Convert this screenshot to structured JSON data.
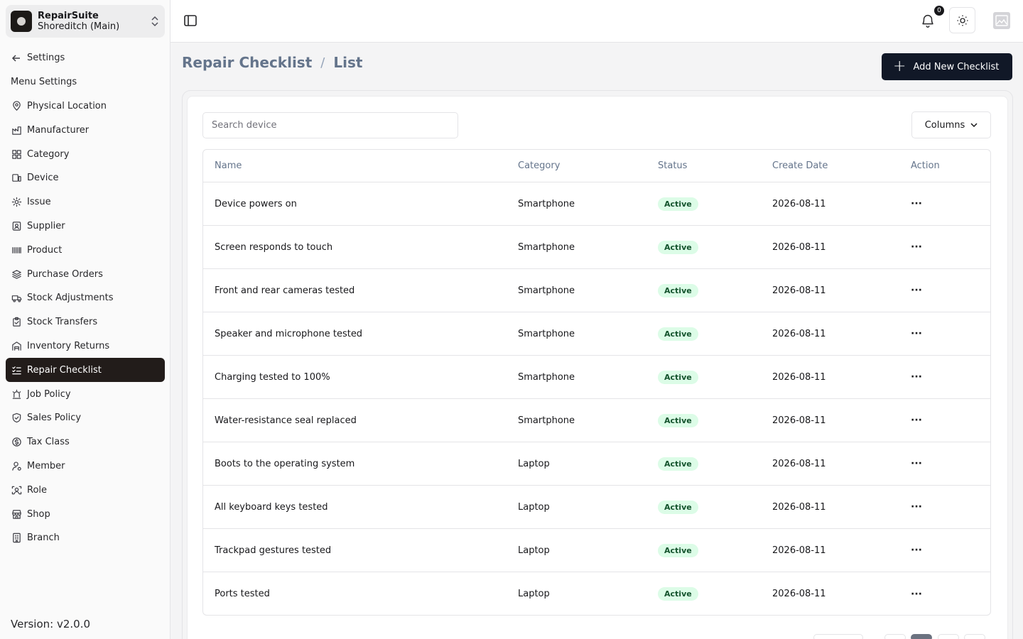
{
  "app": {
    "name": "RepairSuite",
    "branch": "Shoreditch (Main)",
    "version": "Version: v2.0.0"
  },
  "sidebar": {
    "back_label": "Settings",
    "section_label": "Menu Settings",
    "items": [
      {
        "label": "Physical Location",
        "icon": "map-pin-icon"
      },
      {
        "label": "Manufacturer",
        "icon": "factory-icon"
      },
      {
        "label": "Category",
        "icon": "category-icon"
      },
      {
        "label": "Device",
        "icon": "devices-icon"
      },
      {
        "label": "Issue",
        "icon": "cog-icon"
      },
      {
        "label": "Supplier",
        "icon": "contact-icon"
      },
      {
        "label": "Product",
        "icon": "barcode-icon"
      },
      {
        "label": "Purchase Orders",
        "icon": "layers-icon"
      },
      {
        "label": "Stock Adjustments",
        "icon": "truck-icon"
      },
      {
        "label": "Stock Transfers",
        "icon": "clipboard-icon"
      },
      {
        "label": "Inventory Returns",
        "icon": "warehouse-icon"
      },
      {
        "label": "Repair Checklist",
        "icon": "checklist-icon",
        "active": true
      },
      {
        "label": "Job Policy",
        "icon": "siren-icon"
      },
      {
        "label": "Sales Policy",
        "icon": "shield-icon"
      },
      {
        "label": "Tax Class",
        "icon": "currency-icon"
      },
      {
        "label": "Member",
        "icon": "user-icon"
      },
      {
        "label": "Role",
        "icon": "role-icon"
      },
      {
        "label": "Shop",
        "icon": "store-icon"
      },
      {
        "label": "Branch",
        "icon": "building-icon"
      }
    ]
  },
  "topbar": {
    "notification_count": "0"
  },
  "header": {
    "breadcrumb_parent": "Repair Checklist",
    "breadcrumb_current": "List",
    "add_button_label": "Add New Checklist"
  },
  "toolbar": {
    "search_placeholder": "Search device",
    "columns_label": "Columns"
  },
  "table": {
    "headers": [
      "Name",
      "Category",
      "Status",
      "Create Date",
      "Action"
    ],
    "rows": [
      {
        "name": "Device powers on",
        "category": "Smartphone",
        "status": "Active",
        "date": "2026-08-11"
      },
      {
        "name": "Screen responds to touch",
        "category": "Smartphone",
        "status": "Active",
        "date": "2026-08-11"
      },
      {
        "name": "Front and rear cameras tested",
        "category": "Smartphone",
        "status": "Active",
        "date": "2026-08-11"
      },
      {
        "name": "Speaker and microphone tested",
        "category": "Smartphone",
        "status": "Active",
        "date": "2026-08-11"
      },
      {
        "name": "Charging tested to 100%",
        "category": "Smartphone",
        "status": "Active",
        "date": "2026-08-11"
      },
      {
        "name": "Water-resistance seal replaced",
        "category": "Smartphone",
        "status": "Active",
        "date": "2026-08-11"
      },
      {
        "name": "Boots to the operating system",
        "category": "Laptop",
        "status": "Active",
        "date": "2026-08-11"
      },
      {
        "name": "All keyboard keys tested",
        "category": "Laptop",
        "status": "Active",
        "date": "2026-08-11"
      },
      {
        "name": "Trackpad gestures tested",
        "category": "Laptop",
        "status": "Active",
        "date": "2026-08-11"
      },
      {
        "name": "Ports tested",
        "category": "Laptop",
        "status": "Active",
        "date": "2026-08-11"
      }
    ],
    "action_glyph": "···"
  },
  "colors": {
    "active_nav_bg": "#221c1a",
    "primary_button": "#111827",
    "status_badge_bg": "#dcfce7",
    "status_badge_text": "#14532d"
  }
}
